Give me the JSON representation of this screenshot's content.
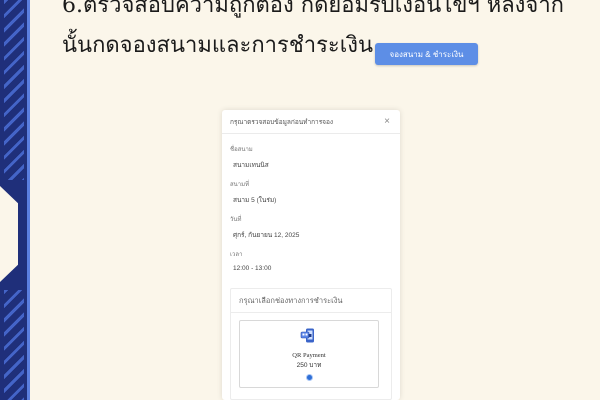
{
  "heading": {
    "line1": "6.ตรวจสอบความถูกต้อง กดยอมรับเงื่อนไขฯ หลังจาก",
    "line2": "นั้นกดจองสนามและการชำระเงิน"
  },
  "book_pay_button": "จองสนาม & ชำระเงิน",
  "modal": {
    "title": "กรุณาตรวจสอบข้อมูลก่อนทำการจอง",
    "close": "×",
    "fields": [
      {
        "label": "ชื่อสนาม",
        "value": "สนามเทนนิส"
      },
      {
        "label": "สนามที่",
        "value": "สนาม 5 (ในร่ม)"
      },
      {
        "label": "วันที่",
        "value": "ศุกร์, กันยายน 12, 2025"
      },
      {
        "label": "เวลา",
        "value": "12:00 - 13:00"
      }
    ],
    "payment": {
      "prompt": "กรุณาเลือกช่องทางการชำระเงิน",
      "method_label": "QR Payment",
      "price": "250 บาท",
      "icon": "qr-payment-icon",
      "selected": true
    }
  },
  "colors": {
    "background": "#fbf6ea",
    "strip": "#1f2f7a",
    "button": "#5d8ee6",
    "radio": "#2f6fd6"
  }
}
